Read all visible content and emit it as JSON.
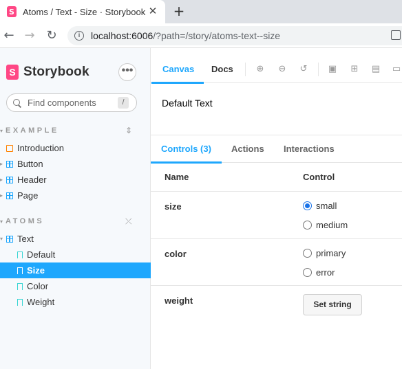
{
  "browser": {
    "tab_title": "Atoms / Text - Size · Storybook",
    "url_host": "localhost:6006",
    "url_path": "/?path=/story/atoms-text--size"
  },
  "sidebar": {
    "brand": "Storybook",
    "search_placeholder": "Find components",
    "search_shortcut": "/",
    "sections": [
      {
        "label": "EXAMPLE",
        "items": [
          {
            "label": "Introduction",
            "icon": "document-icon"
          },
          {
            "label": "Button",
            "icon": "component-icon"
          },
          {
            "label": "Header",
            "icon": "component-icon"
          },
          {
            "label": "Page",
            "icon": "component-icon"
          }
        ]
      },
      {
        "label": "ATOMS",
        "items": [
          {
            "label": "Text",
            "icon": "component-icon"
          },
          {
            "label": "Default",
            "icon": "bookmark-icon"
          },
          {
            "label": "Size",
            "icon": "bookmark-icon",
            "selected": true
          },
          {
            "label": "Color",
            "icon": "bookmark-icon"
          },
          {
            "label": "Weight",
            "icon": "bookmark-icon"
          }
        ]
      }
    ]
  },
  "main": {
    "tabs": [
      "Canvas",
      "Docs"
    ],
    "active_tab": "Canvas",
    "preview_text": "Default Text",
    "panel_tabs": [
      "Controls (3)",
      "Actions",
      "Interactions"
    ],
    "active_panel": "Controls (3)",
    "columns": [
      "Name",
      "Control"
    ],
    "controls": [
      {
        "name": "size",
        "options": [
          "small",
          "medium"
        ],
        "selected": "small"
      },
      {
        "name": "color",
        "options": [
          "primary",
          "error"
        ],
        "selected": null
      },
      {
        "name": "weight",
        "button": "Set string"
      }
    ]
  },
  "colors": {
    "accent": "#1ea7fd",
    "brand": "#ff4785"
  }
}
